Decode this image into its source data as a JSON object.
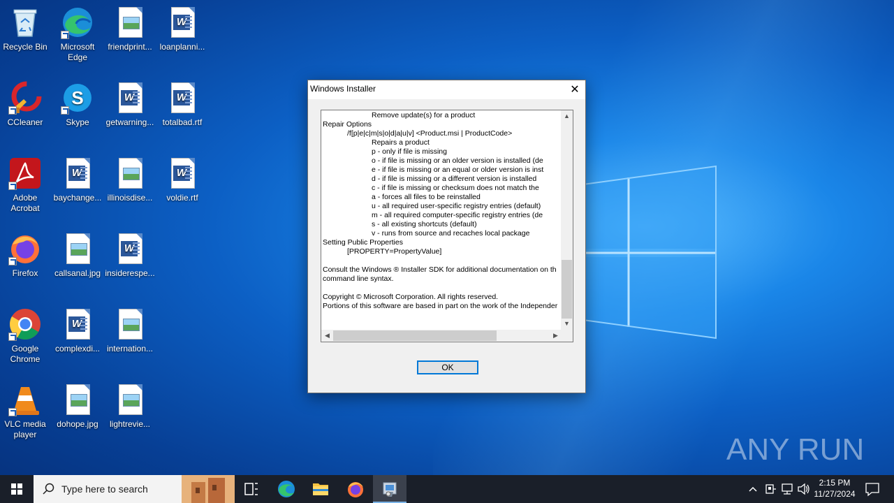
{
  "desktop": {
    "icons": [
      {
        "label": "Recycle Bin"
      },
      {
        "label": "Microsoft Edge"
      },
      {
        "label": "friendprint..."
      },
      {
        "label": "loanplanni..."
      },
      {
        "label": "CCleaner"
      },
      {
        "label": "Skype"
      },
      {
        "label": "getwarning..."
      },
      {
        "label": "totalbad.rtf"
      },
      {
        "label": "Adobe Acrobat"
      },
      {
        "label": "baychange..."
      },
      {
        "label": "illinoisdise..."
      },
      {
        "label": "voldie.rtf"
      },
      {
        "label": "Firefox"
      },
      {
        "label": "callsanal.jpg"
      },
      {
        "label": "insiderespe..."
      },
      {
        "label": "Google Chrome"
      },
      {
        "label": "complexdi..."
      },
      {
        "label": "internation..."
      },
      {
        "label": "VLC media player"
      },
      {
        "label": "dohope.jpg"
      },
      {
        "label": "lightrevie..."
      }
    ],
    "watermark": "ANY RUN"
  },
  "dialog": {
    "title": "Windows Installer",
    "close_glyph": "✕",
    "lines": [
      "                        Remove update(s) for a product",
      "Repair Options",
      "            /f[p|e|c|m|s|o|d|a|u|v] <Product.msi | ProductCode>",
      "                        Repairs a product",
      "                        p - only if file is missing",
      "                        o - if file is missing or an older version is installed (de",
      "                        e - if file is missing or an equal or older version is inst",
      "                        d - if file is missing or a different version is installed",
      "                        c - if file is missing or checksum does not match the",
      "                        a - forces all files to be reinstalled",
      "                        u - all required user-specific registry entries (default)",
      "                        m - all required computer-specific registry entries (de",
      "                        s - all existing shortcuts (default)",
      "                        v - runs from source and recaches local package",
      "Setting Public Properties",
      "            [PROPERTY=PropertyValue]",
      "",
      "Consult the Windows ® Installer SDK for additional documentation on th",
      "command line syntax.",
      "",
      "Copyright © Microsoft Corporation. All rights reserved.",
      "Portions of this software are based in part on the work of the Independer"
    ],
    "ok_label": "OK"
  },
  "taskbar": {
    "search_placeholder": "Type here to search",
    "time": "2:15 PM",
    "date": "11/27/2024"
  }
}
